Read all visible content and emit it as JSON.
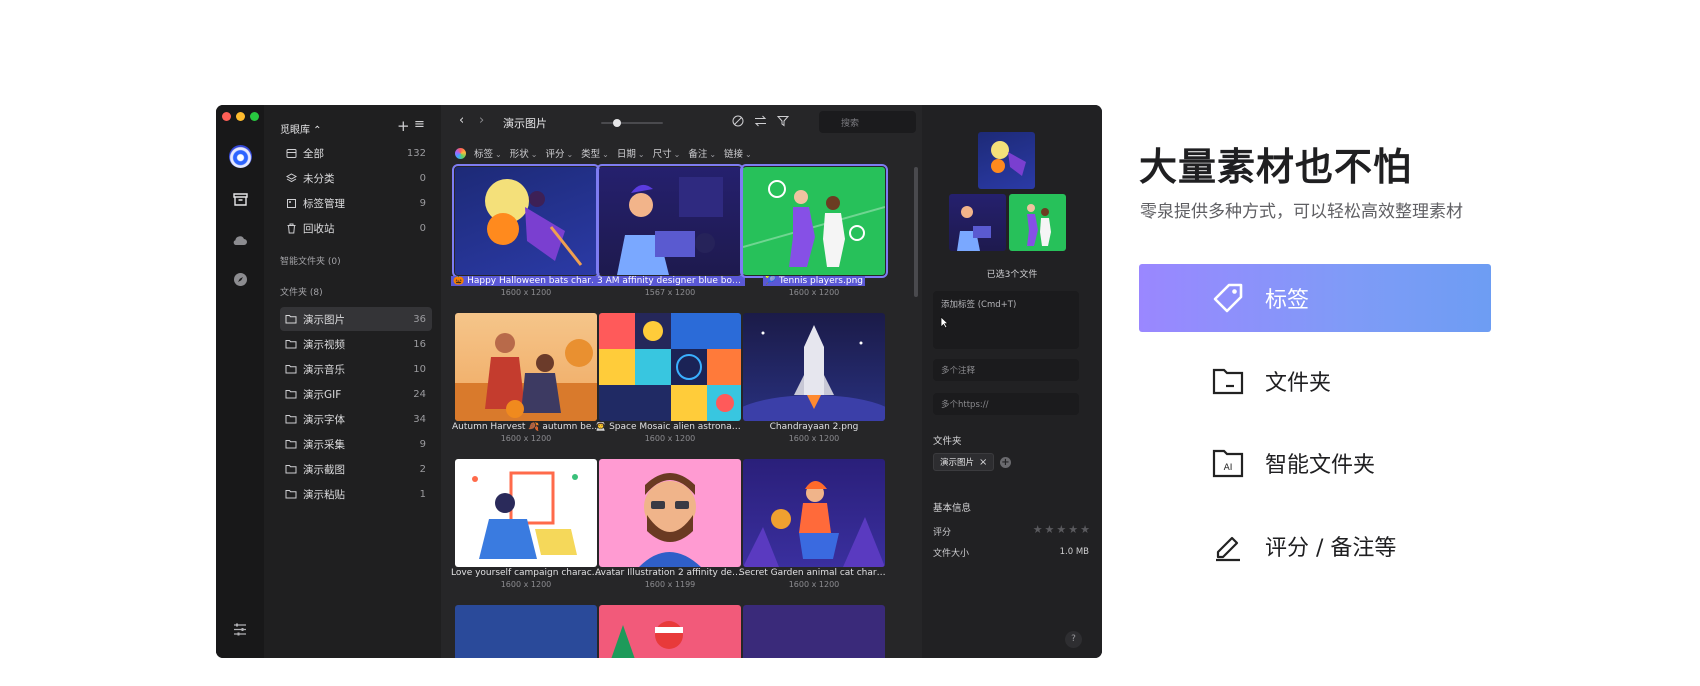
{
  "sidebar": {
    "library_title": "觅眼库 ⌃",
    "items": [
      {
        "label": "全部",
        "count": "132"
      },
      {
        "label": "未分类",
        "count": "0"
      },
      {
        "label": "标签管理",
        "count": "9"
      },
      {
        "label": "回收站",
        "count": "0"
      }
    ],
    "smart_folders_label": "智能文件夹 (0)",
    "folders_label": "文件夹 (8)",
    "folders": [
      {
        "label": "演示图片",
        "count": "36"
      },
      {
        "label": "演示视频",
        "count": "16"
      },
      {
        "label": "演示音乐",
        "count": "10"
      },
      {
        "label": "演示GIF",
        "count": "24"
      },
      {
        "label": "演示字体",
        "count": "34"
      },
      {
        "label": "演示采集",
        "count": "9"
      },
      {
        "label": "演示截图",
        "count": "2"
      },
      {
        "label": "演示粘贴",
        "count": "1"
      }
    ]
  },
  "toolbar": {
    "title": "演示图片",
    "search_placeholder": "搜索",
    "filters": [
      "标签",
      "形状",
      "评分",
      "类型",
      "日期",
      "尺寸",
      "备注",
      "链接"
    ]
  },
  "grid": [
    {
      "name": "🎃 Happy Halloween bats charac...",
      "dims": "1600 x 1200",
      "selected": true
    },
    {
      "name": "3 AM affinity designer blue boy ...",
      "dims": "1567 x 1200",
      "selected": true
    },
    {
      "name": "🎾 Tennis players.png",
      "dims": "1600 x 1200",
      "selected": true
    },
    {
      "name": "Autumn Harvest 🍂 autumn be...",
      "dims": "1600 x 1200",
      "selected": false
    },
    {
      "name": "👨‍🚀 Space Mosaic alien astronaut...",
      "dims": "1600 x 1200",
      "selected": false
    },
    {
      "name": "Chandrayaan 2.png",
      "dims": "1600 x 1200",
      "selected": false
    },
    {
      "name": "Love yourself campaign charact...",
      "dims": "1600 x 1200",
      "selected": false
    },
    {
      "name": "Avatar Illustration 2 affinity desi...",
      "dims": "1600 x 1199",
      "selected": false
    },
    {
      "name": "Secret Garden animal cat chara...",
      "dims": "1600 x 1200",
      "selected": false
    }
  ],
  "inspector": {
    "selected_count": "已选3个文件",
    "tag_placeholder": "添加标签 (Cmd+T)",
    "note_placeholder": "多个注释",
    "link_placeholder": "多个https://",
    "folder_label": "文件夹",
    "folder_chip": "演示图片",
    "info_label": "基本信息",
    "rating_label": "评分",
    "rating": 0,
    "size_label": "文件大小",
    "size_value": "1.0 MB",
    "help": "?"
  },
  "promo": {
    "headline": "大量素材也不怕",
    "subline": "零泉提供多种方式，可以轻松高效整理素材",
    "features": [
      {
        "label": "标签",
        "icon": "tag-icon",
        "active": true
      },
      {
        "label": "文件夹",
        "icon": "folder-icon",
        "active": false
      },
      {
        "label": "智能文件夹",
        "icon": "ai-folder-icon",
        "active": false
      },
      {
        "label": "评分 / 备注等",
        "icon": "edit-icon",
        "active": false
      }
    ]
  },
  "colors": {
    "accent_gradient_start": "#9a87ff",
    "accent_gradient_end": "#6d9df3",
    "selection": "#7e7cf2",
    "window_bg": "#232325"
  }
}
